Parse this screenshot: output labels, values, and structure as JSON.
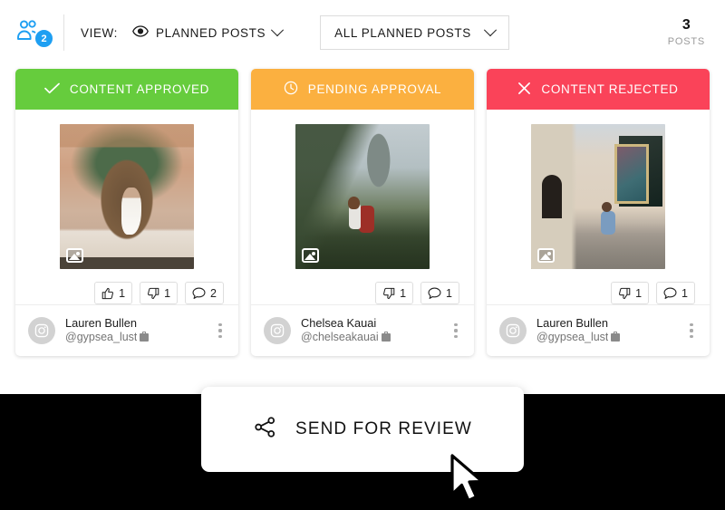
{
  "toolbar": {
    "collaborators_icon": "people-icon",
    "collaborators_count": "2",
    "view_label": "VIEW:",
    "view_icon": "eye-icon",
    "view_value": "PLANNED POSTS",
    "view_caret_icon": "chevron-down-icon",
    "filter_value": "ALL PLANNED POSTS",
    "filter_caret_icon": "chevron-down-icon",
    "posts_count": "3",
    "posts_label": "POSTS"
  },
  "colors": {
    "approved": "#66cc3d",
    "pending": "#fbb040",
    "rejected": "#fa4359",
    "badge_blue": "#1e9ff2",
    "bottom_bar": "#000000"
  },
  "cards": [
    {
      "status_label": "CONTENT APPROVED",
      "status_icon": "check-icon",
      "status_color": "#66cc3d",
      "media_icon": "gallery-icon",
      "media_alt": "woman in white dress standing in an ornate pink palace archway",
      "reactions": [
        {
          "icon": "thumbs-up-icon",
          "count": "1"
        },
        {
          "icon": "thumbs-down-icon",
          "count": "1"
        },
        {
          "icon": "comment-icon",
          "count": "2"
        }
      ],
      "avatar_icon": "instagram-icon",
      "user_name": "Lauren Bullen",
      "user_handle": "@gypsea_lust",
      "account_type_icon": "briefcase-icon",
      "menu_icon": "kebab-menu-icon"
    },
    {
      "status_label": "PENDING APPROVAL",
      "status_icon": "clock-icon",
      "status_color": "#fbb040",
      "media_icon": "gallery-icon",
      "media_alt": "hiker with red backpack in misty green jungle with rock spire",
      "reactions": [
        {
          "icon": "thumbs-down-icon",
          "count": "1"
        },
        {
          "icon": "comment-icon",
          "count": "1"
        }
      ],
      "avatar_icon": "instagram-icon",
      "user_name": "Chelsea Kauai",
      "user_handle": "@chelseakauai",
      "account_type_icon": "briefcase-icon",
      "menu_icon": "kebab-menu-icon"
    },
    {
      "status_label": "CONTENT REJECTED",
      "status_icon": "close-icon",
      "status_color": "#fa4359",
      "media_icon": "gallery-icon",
      "media_alt": "woman in blue dress sitting on steps in a sunlit Indian street",
      "reactions": [
        {
          "icon": "thumbs-down-icon",
          "count": "1"
        },
        {
          "icon": "comment-icon",
          "count": "1"
        }
      ],
      "avatar_icon": "instagram-icon",
      "user_name": "Lauren Bullen",
      "user_handle": "@gypsea_lust",
      "account_type_icon": "briefcase-icon",
      "menu_icon": "kebab-menu-icon"
    }
  ],
  "footer": {
    "send_icon": "share-icon",
    "send_label": "SEND FOR REVIEW",
    "cursor_icon": "mouse-pointer-icon"
  }
}
